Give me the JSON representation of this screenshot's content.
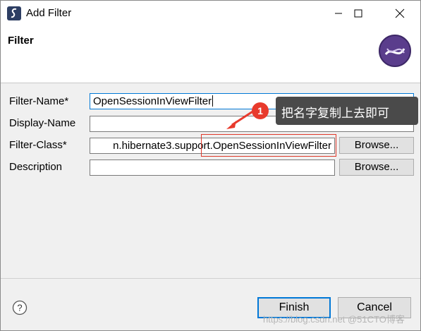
{
  "window": {
    "title": "Add Filter",
    "header_title": "Filter"
  },
  "form": {
    "filter_name": {
      "label": "Filter-Name*",
      "value": "OpenSessionInViewFilter"
    },
    "display_name": {
      "label": "Display-Name",
      "value": ""
    },
    "filter_class": {
      "label": "Filter-Class*",
      "value": "n.hibernate3.support.OpenSessionInViewFilter"
    },
    "description": {
      "label": "Description",
      "value": ""
    },
    "browse_label": "Browse..."
  },
  "annotation": {
    "badge": "1",
    "text": "把名字复制上去即可",
    "color": "#e83a2c"
  },
  "footer": {
    "help_glyph": "?",
    "finish_label": "Finish",
    "cancel_label": "Cancel"
  },
  "watermark": "https://blog.csdn.net @51CTO博客",
  "icons": [
    "eclipse-s-icon",
    "minimize-icon",
    "maximize-icon",
    "close-icon",
    "filter-logo-icon",
    "help-icon"
  ],
  "colors": {
    "focus": "#0078d7",
    "callout_bg": "#4a4a4a"
  }
}
